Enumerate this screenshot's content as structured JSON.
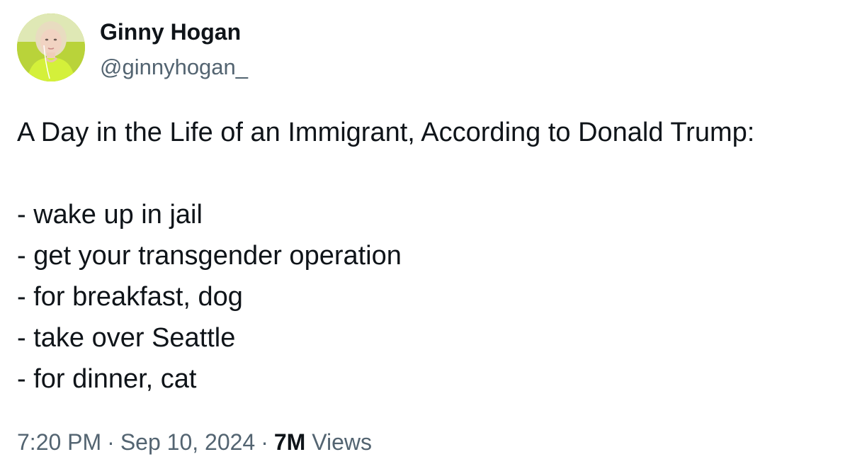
{
  "author": {
    "display_name": "Ginny Hogan",
    "handle": "@ginnyhogan_"
  },
  "tweet": {
    "headline": "A Day in the Life of an Immigrant, According to Donald Trump:",
    "items": [
      "- wake up in jail",
      "- get your transgender operation",
      "- for breakfast, dog",
      "- take over Seattle",
      "- for dinner, cat"
    ]
  },
  "meta": {
    "time": "7:20 PM",
    "separator": "·",
    "date": "Sep 10, 2024",
    "views_count": "7M",
    "views_label": "Views"
  },
  "colors": {
    "text_primary": "#0f1419",
    "text_secondary": "#536471",
    "avatar_accent": "#c4dc3f"
  }
}
